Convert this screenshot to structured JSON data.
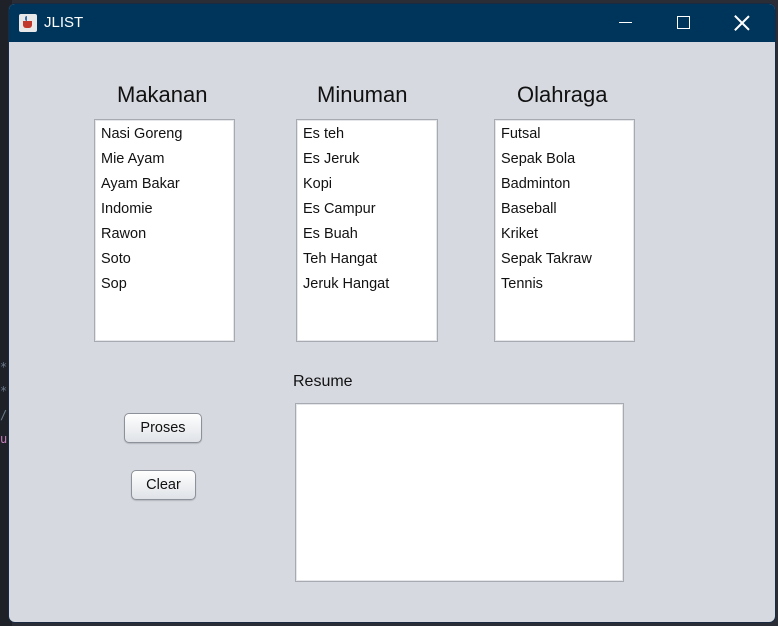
{
  "window": {
    "title": "JLIST",
    "accent_color": "#00355b"
  },
  "columns": [
    {
      "heading": "Makanan",
      "items": [
        "Nasi Goreng",
        "Mie Ayam",
        "Ayam Bakar",
        "Indomie",
        "Rawon",
        "Soto",
        "Sop"
      ]
    },
    {
      "heading": "Minuman",
      "items": [
        "Es teh",
        "Es Jeruk",
        "Kopi",
        "Es Campur",
        "Es Buah",
        "Teh Hangat",
        "Jeruk Hangat"
      ]
    },
    {
      "heading": "Olahraga",
      "items": [
        "Futsal",
        "Sepak Bola",
        "Badminton",
        "Baseball",
        "Kriket",
        "Sepak Takraw",
        "Tennis"
      ]
    }
  ],
  "resume": {
    "label": "Resume",
    "value": ""
  },
  "buttons": {
    "proses": "Proses",
    "clear": "Clear"
  }
}
